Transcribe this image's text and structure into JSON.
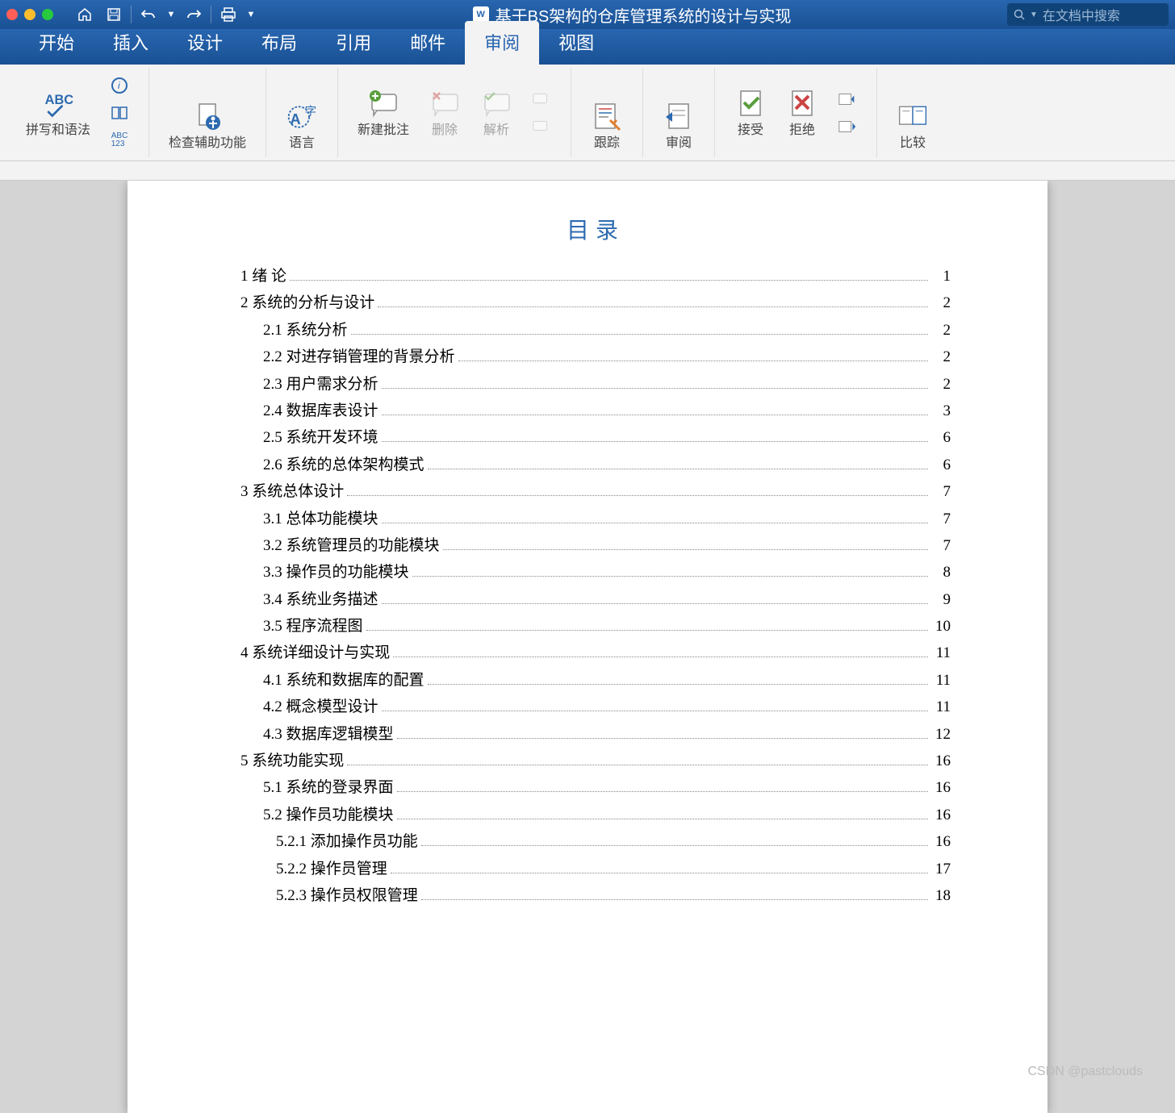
{
  "titlebar": {
    "doc_title": "基于BS架构的仓库管理系统的设计与实现",
    "search_placeholder": "在文档中搜索"
  },
  "tabs": [
    {
      "label": "开始"
    },
    {
      "label": "插入"
    },
    {
      "label": "设计"
    },
    {
      "label": "布局"
    },
    {
      "label": "引用"
    },
    {
      "label": "邮件"
    },
    {
      "label": "审阅"
    },
    {
      "label": "视图"
    }
  ],
  "active_tab": 6,
  "ribbon": {
    "spelling": "拼写和语法",
    "accessibility": "检查辅助功能",
    "language": "语言",
    "new_comment": "新建批注",
    "delete": "删除",
    "resolve": "解析",
    "track": "跟踪",
    "review": "审阅",
    "accept": "接受",
    "reject": "拒绝",
    "compare": "比较"
  },
  "toc": {
    "title": "目录",
    "entries": [
      {
        "level": 1,
        "text": "1 绪  论",
        "page": "1"
      },
      {
        "level": 1,
        "text": "2 系统的分析与设计",
        "page": "2"
      },
      {
        "level": 2,
        "text": "2.1 系统分析",
        "page": "2"
      },
      {
        "level": 2,
        "text": "2.2 对进存销管理的背景分析",
        "page": "2"
      },
      {
        "level": 2,
        "text": "2.3 用户需求分析",
        "page": "2"
      },
      {
        "level": 2,
        "text": "2.4 数据库表设计",
        "page": "3"
      },
      {
        "level": 2,
        "text": "2.5 系统开发环境",
        "page": "6"
      },
      {
        "level": 2,
        "text": "2.6 系统的总体架构模式",
        "page": "6"
      },
      {
        "level": 1,
        "text": "3  系统总体设计",
        "page": "7"
      },
      {
        "level": 2,
        "text": "3.1  总体功能模块",
        "page": "7"
      },
      {
        "level": 2,
        "text": "3.2 系统管理员的功能模块",
        "page": "7"
      },
      {
        "level": 2,
        "text": "3.3 操作员的功能模块",
        "page": "8"
      },
      {
        "level": 2,
        "text": "3.4 系统业务描述",
        "page": "9"
      },
      {
        "level": 2,
        "text": "3.5 程序流程图",
        "page": "10"
      },
      {
        "level": 1,
        "text": "4 系统详细设计与实现",
        "page": "11"
      },
      {
        "level": 2,
        "text": "4.1 系统和数据库的配置",
        "page": "11"
      },
      {
        "level": 2,
        "text": "4.2 概念模型设计",
        "page": "11"
      },
      {
        "level": 2,
        "text": "4.3 数据库逻辑模型",
        "page": "12"
      },
      {
        "level": 1,
        "text": "5 系统功能实现",
        "page": "16"
      },
      {
        "level": 2,
        "text": "5.1 系统的登录界面",
        "page": "16"
      },
      {
        "level": 2,
        "text": "5.2 操作员功能模块",
        "page": "16"
      },
      {
        "level": 3,
        "text": "5.2.1 添加操作员功能",
        "page": "16"
      },
      {
        "level": 3,
        "text": "5.2.2 操作员管理",
        "page": "17"
      },
      {
        "level": 3,
        "text": "5.2.3 操作员权限管理",
        "page": "18"
      }
    ]
  },
  "watermark": "CSDN @pastclouds"
}
